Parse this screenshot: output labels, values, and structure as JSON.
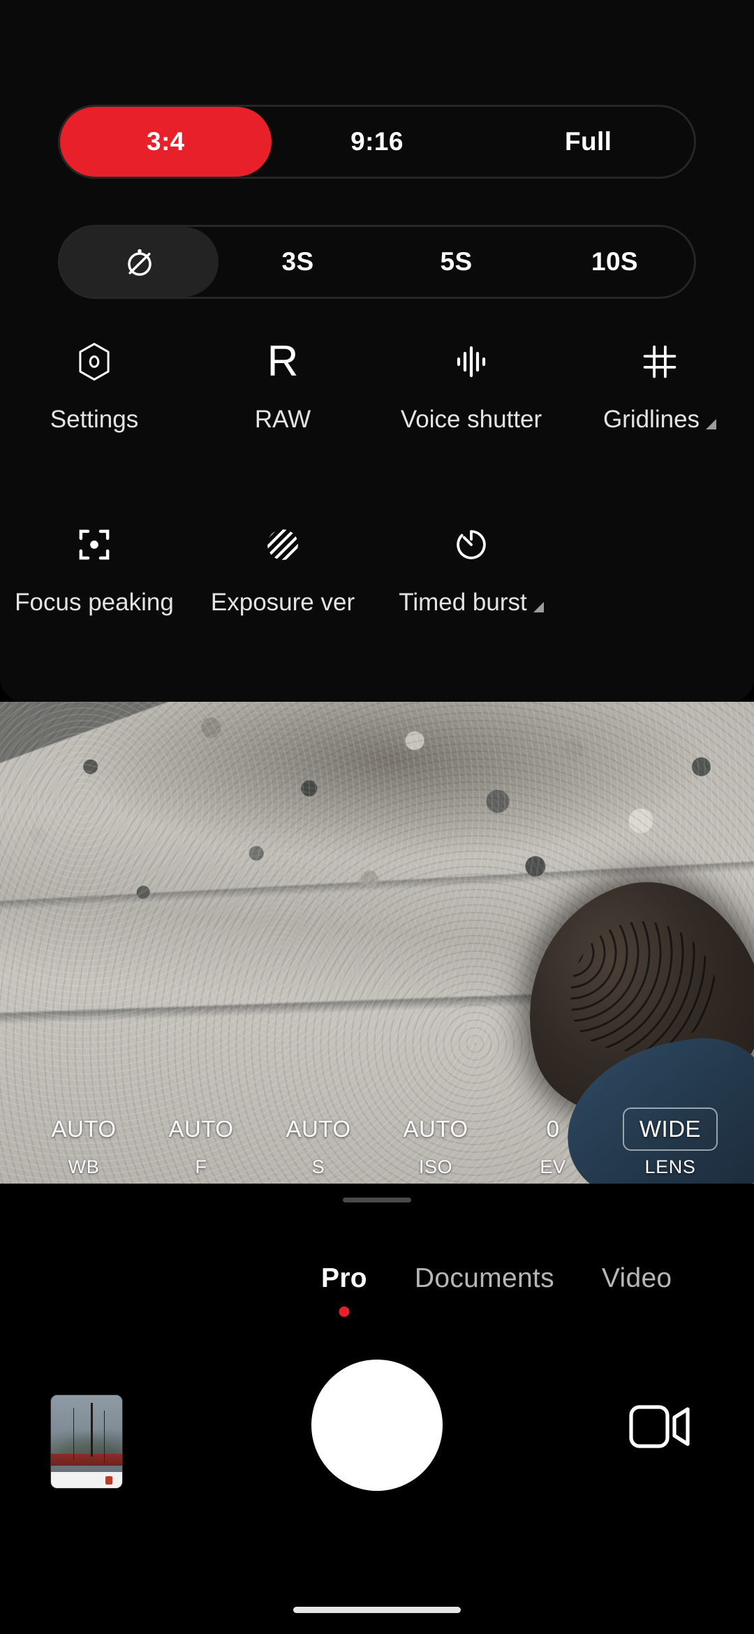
{
  "settings_panel": {
    "aspect_ratio": {
      "name": "aspect-ratio-selector",
      "options": [
        {
          "label": "3:4",
          "selected": true
        },
        {
          "label": "9:16",
          "selected": false
        },
        {
          "label": "Full",
          "selected": false
        }
      ]
    },
    "timer": {
      "name": "timer-selector",
      "options": [
        {
          "label": "",
          "icon": "timer-off-icon",
          "selected": true
        },
        {
          "label": "3S",
          "icon": "",
          "selected": false
        },
        {
          "label": "5S",
          "icon": "",
          "selected": false
        },
        {
          "label": "10S",
          "icon": "",
          "selected": false
        }
      ]
    },
    "features": [
      {
        "label": "Settings",
        "icon": "hexagon-aperture-icon",
        "caret": false
      },
      {
        "label": "RAW",
        "icon": "raw-letter-icon",
        "caret": false
      },
      {
        "label": "Voice shutter",
        "icon": "waveform-icon",
        "caret": false
      },
      {
        "label": "Gridlines",
        "icon": "grid-frame-icon",
        "caret": true
      },
      {
        "label": "Focus peaking",
        "icon": "focus-point-icon",
        "caret": false
      },
      {
        "label": "Exposure ver",
        "icon": "zebra-stripes-icon",
        "caret": false
      },
      {
        "label": "Timed burst",
        "icon": "stopwatch-icon",
        "caret": true
      }
    ]
  },
  "pro_controls": [
    {
      "value": "AUTO",
      "label": "WB",
      "boxed": false
    },
    {
      "value": "AUTO",
      "label": "F",
      "boxed": false
    },
    {
      "value": "AUTO",
      "label": "S",
      "boxed": false
    },
    {
      "value": "AUTO",
      "label": "ISO",
      "boxed": false
    },
    {
      "value": "0",
      "label": "EV",
      "boxed": false
    },
    {
      "value": "WIDE",
      "label": "LENS",
      "boxed": true
    }
  ],
  "modes": [
    {
      "label": "Pro",
      "active": true
    },
    {
      "label": "Documents",
      "active": false
    },
    {
      "label": "Video",
      "active": false
    }
  ],
  "bottom": {
    "thumbnail_name": "gallery-thumbnail",
    "shutter_name": "shutter-button",
    "video_toggle_name": "video-camera-icon"
  },
  "colors": {
    "accent_red": "#e8202a",
    "panel_bg": "#0a0a0a",
    "segment_selected_grey": "#232323"
  }
}
